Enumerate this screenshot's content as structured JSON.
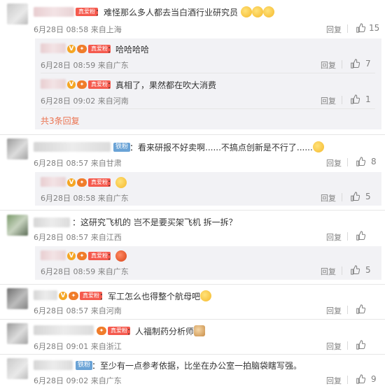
{
  "comments": [
    {
      "text": "：难怪那么多人都去当白酒行业研究员",
      "fan_badge": "真爱粉",
      "meta": "6月28日 08:58 来自上海",
      "reply_label": "回复",
      "likes": "15",
      "replies": [
        {
          "text": "：哈哈哈哈",
          "fan_badge": "真爱粉",
          "meta": "6月28日 08:59 来自广东",
          "reply_label": "回复",
          "likes": "7"
        },
        {
          "text": "：真相了，果然都在吹大消费",
          "fan_badge": "真爱粉",
          "meta": "6月28日 09:02 来自河南",
          "reply_label": "回复",
          "likes": "1"
        }
      ],
      "expand_label": "共3条回复"
    },
    {
      "text": "：看来研报不好卖啊......不搞点创新是不行了......",
      "iron_badge": "铁粉",
      "meta": "6月28日 08:57 来自甘肃",
      "reply_label": "回复",
      "likes": "8",
      "replies": [
        {
          "text": "：",
          "fan_badge": "真爱粉",
          "meta": "6月28日 08:58 来自广东",
          "reply_label": "回复",
          "likes": "5"
        }
      ]
    },
    {
      "text": "：这研究飞机的 岂不是要买架飞机 拆一拆？",
      "meta": "6月28日 08:57 来自江西",
      "reply_label": "回复",
      "likes": "",
      "replies": [
        {
          "text": "：",
          "fan_badge": "真爱粉",
          "meta": "6月28日 08:59 来自广东",
          "reply_label": "回复",
          "likes": "5"
        }
      ]
    },
    {
      "text": "：军工怎么也得整个航母吧",
      "fan_badge": "真爱粉",
      "meta": "6月28日 08:57 来自河南",
      "reply_label": "回复",
      "likes": ""
    },
    {
      "text": "：人福制药分析师",
      "fan_badge": "真爱粉",
      "meta": "6月28日 09:01 来自浙江",
      "reply_label": "回复",
      "likes": ""
    },
    {
      "text": "：至少有一点参考依据，比坐在办公室一拍脑袋瞎写强。",
      "iron_badge": "铁粉",
      "meta": "6月28日 09:02 来自广东",
      "reply_label": "回复",
      "likes": "9"
    }
  ],
  "icons": {
    "like": "thumbs-up-icon",
    "verified": "v-badge-icon",
    "level": "level-icon"
  },
  "colors": {
    "accent": "#eb7350",
    "fan_badge": "#f55a4e",
    "iron_badge": "#6aa3d6",
    "meta": "#808080"
  }
}
